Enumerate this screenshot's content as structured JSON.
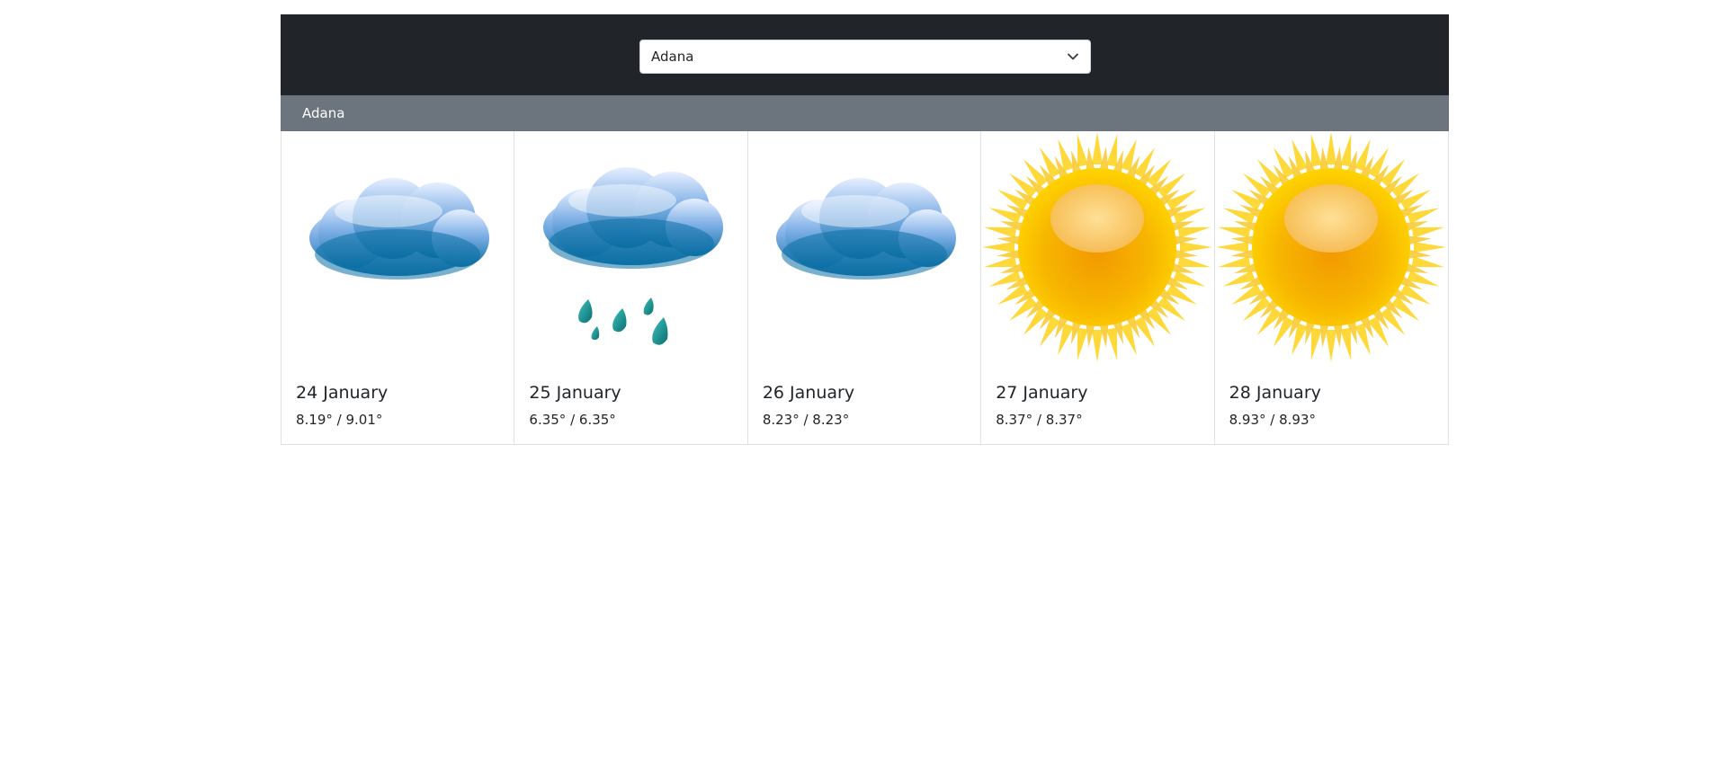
{
  "header": {
    "select_value": "Adana",
    "select_icon": "chevron-down-icon"
  },
  "city_title": "Adana",
  "forecast": [
    {
      "date": "24 January",
      "temps": "8.19° / 9.01°",
      "icon": "cloud-icon"
    },
    {
      "date": "25 January",
      "temps": "6.35° / 6.35°",
      "icon": "rain-cloud-icon"
    },
    {
      "date": "26 January",
      "temps": "8.23° / 8.23°",
      "icon": "cloud-icon"
    },
    {
      "date": "27 January",
      "temps": "8.37° / 8.37°",
      "icon": "sun-icon"
    },
    {
      "date": "28 January",
      "temps": "8.93° / 8.93°",
      "icon": "sun-icon"
    }
  ],
  "colors": {
    "header_bg": "#212529",
    "title_bar_bg": "#6c757d",
    "cloud_top": "#dbe7ff",
    "cloud_bottom": "#0b6fa4",
    "rain_drop": "#138a8a",
    "sun_core": "#f7a400",
    "sun_ray": "#ffd83a"
  }
}
